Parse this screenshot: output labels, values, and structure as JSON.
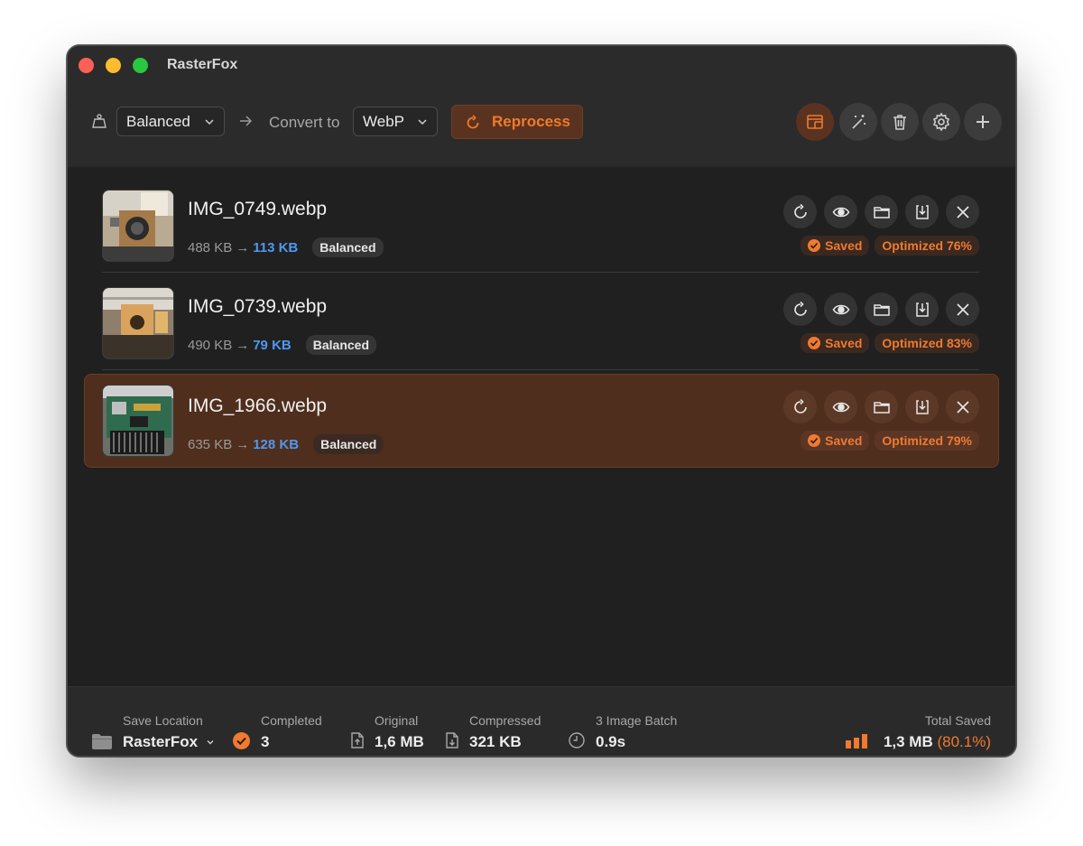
{
  "app": {
    "title": "RasterFox"
  },
  "toolbar": {
    "preset": "Balanced",
    "convert_label": "Convert to",
    "format": "WebP",
    "reprocess_label": "Reprocess"
  },
  "files": [
    {
      "name": "IMG_0749.webp",
      "original": "488 KB",
      "arrow": "→",
      "compressed": "113 KB",
      "preset": "Balanced",
      "saved_label": "Saved",
      "optimized": "Optimized 76%"
    },
    {
      "name": "IMG_0739.webp",
      "original": "490 KB",
      "arrow": "→",
      "compressed": "79 KB",
      "preset": "Balanced",
      "saved_label": "Saved",
      "optimized": "Optimized 83%"
    },
    {
      "name": "IMG_1966.webp",
      "original": "635 KB",
      "arrow": "→",
      "compressed": "128 KB",
      "preset": "Balanced",
      "saved_label": "Saved",
      "optimized": "Optimized 79%"
    }
  ],
  "footer": {
    "save_location_label": "Save Location",
    "save_location_value": "RasterFox",
    "completed_label": "Completed",
    "completed_value": "3",
    "original_label": "Original",
    "original_value": "1,6 MB",
    "compressed_label": "Compressed",
    "compressed_value": "321 KB",
    "batch_label": "3 Image Batch",
    "batch_value": "0.9s",
    "total_label": "Total Saved",
    "total_value": "1,3 MB",
    "total_pct": "(80.1%)"
  },
  "colors": {
    "accent": "#ef7a30",
    "link": "#4f97f0"
  }
}
